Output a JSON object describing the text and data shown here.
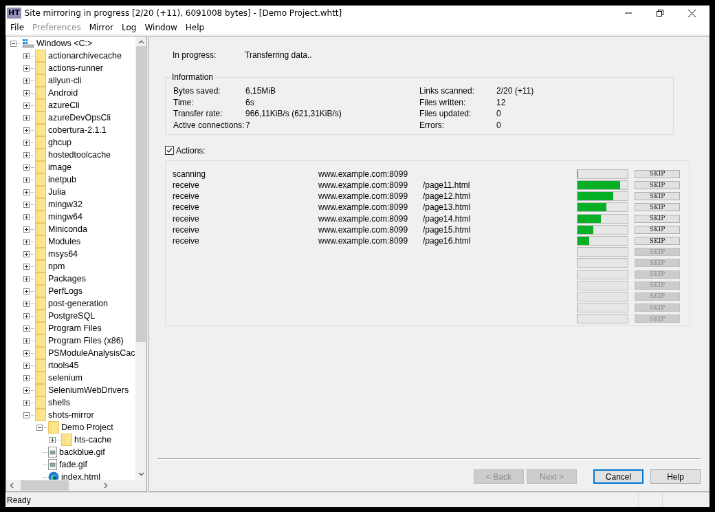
{
  "window": {
    "app_icon": "HT",
    "title": "Site mirroring in progress [2/20 (+11), 6091008 bytes] - [Demo Project.whtt]"
  },
  "menu": [
    {
      "label": "File",
      "disabled": false
    },
    {
      "label": "Preferences",
      "disabled": true
    },
    {
      "label": "Mirror",
      "disabled": false
    },
    {
      "label": "Log",
      "disabled": false
    },
    {
      "label": "Window",
      "disabled": false
    },
    {
      "label": "Help",
      "disabled": false
    }
  ],
  "tree": [
    {
      "label": "Windows <C:>",
      "kind": "drive",
      "expanded": true,
      "children": [
        {
          "label": "actionarchivecache",
          "kind": "folder",
          "expanded": false
        },
        {
          "label": "actions-runner",
          "kind": "folder",
          "expanded": false
        },
        {
          "label": "aliyun-cli",
          "kind": "folder",
          "expanded": false
        },
        {
          "label": "Android",
          "kind": "folder",
          "expanded": false
        },
        {
          "label": "azureCli",
          "kind": "folder",
          "expanded": false
        },
        {
          "label": "azureDevOpsCli",
          "kind": "folder",
          "expanded": false
        },
        {
          "label": "cobertura-2.1.1",
          "kind": "folder",
          "expanded": false
        },
        {
          "label": "ghcup",
          "kind": "folder",
          "expanded": false
        },
        {
          "label": "hostedtoolcache",
          "kind": "folder",
          "expanded": false
        },
        {
          "label": "image",
          "kind": "folder",
          "expanded": false
        },
        {
          "label": "inetpub",
          "kind": "folder",
          "expanded": false
        },
        {
          "label": "Julia",
          "kind": "folder",
          "expanded": false
        },
        {
          "label": "mingw32",
          "kind": "folder",
          "expanded": false
        },
        {
          "label": "mingw64",
          "kind": "folder",
          "expanded": false
        },
        {
          "label": "Miniconda",
          "kind": "folder",
          "expanded": false
        },
        {
          "label": "Modules",
          "kind": "folder",
          "expanded": false
        },
        {
          "label": "msys64",
          "kind": "folder",
          "expanded": false
        },
        {
          "label": "npm",
          "kind": "folder",
          "expanded": false
        },
        {
          "label": "Packages",
          "kind": "folder",
          "expanded": false
        },
        {
          "label": "PerfLogs",
          "kind": "folder",
          "expanded": false
        },
        {
          "label": "post-generation",
          "kind": "folder",
          "expanded": false
        },
        {
          "label": "PostgreSQL",
          "kind": "folder",
          "expanded": false
        },
        {
          "label": "Program Files",
          "kind": "folder",
          "expanded": false
        },
        {
          "label": "Program Files (x86)",
          "kind": "folder",
          "expanded": false
        },
        {
          "label": "PSModuleAnalysisCac",
          "kind": "folder",
          "expanded": false
        },
        {
          "label": "rtools45",
          "kind": "folder",
          "expanded": false
        },
        {
          "label": "selenium",
          "kind": "folder",
          "expanded": false
        },
        {
          "label": "SeleniumWebDrivers",
          "kind": "folder",
          "expanded": false
        },
        {
          "label": "shells",
          "kind": "folder",
          "expanded": false
        },
        {
          "label": "shots-mirror",
          "kind": "folder",
          "expanded": true,
          "children": [
            {
              "label": "Demo Project",
              "kind": "folder",
              "expanded": true,
              "children": [
                {
                  "label": "hts-cache",
                  "kind": "folder",
                  "expanded": false
                }
              ]
            },
            {
              "label": "backblue.gif",
              "kind": "image-file"
            },
            {
              "label": "fade.gif",
              "kind": "image-file"
            },
            {
              "label": "index.html",
              "kind": "web-file"
            }
          ]
        }
      ]
    }
  ],
  "progress": {
    "label": "In progress:",
    "value": "Transferring data.."
  },
  "information": {
    "title": "Information",
    "left": [
      {
        "label": "Bytes saved:",
        "value": "6,15MiB"
      },
      {
        "label": "Time:",
        "value": "6s"
      },
      {
        "label": "Transfer rate:",
        "value": "966,11KiB/s (621,31KiB/s)"
      },
      {
        "label": "Active connections:",
        "value": "7"
      }
    ],
    "right": [
      {
        "label": "Links scanned:",
        "value": "2/20 (+11)"
      },
      {
        "label": "Files written:",
        "value": "12"
      },
      {
        "label": "Files updated:",
        "value": "0"
      },
      {
        "label": "Errors:",
        "value": "0"
      }
    ]
  },
  "actions": {
    "label": "Actions:",
    "checked": true,
    "rows": [
      {
        "action": "scanning",
        "host": "www.example.com:8099",
        "level": 0.02,
        "skip": "SKIP",
        "disabled": false
      },
      {
        "action": "receive",
        "host": "www.example.com:8099",
        "path": "/page11.html",
        "level": 0.85,
        "skip": "SKIP",
        "disabled": false
      },
      {
        "action": "receive",
        "host": "www.example.com:8099",
        "path": "/page12.html",
        "level": 0.71,
        "skip": "SKIP",
        "disabled": false
      },
      {
        "action": "receive",
        "host": "www.example.com:8099",
        "path": "/page13.html",
        "level": 0.57,
        "skip": "SKIP",
        "disabled": false
      },
      {
        "action": "receive",
        "host": "www.example.com:8099",
        "path": "/page14.html",
        "level": 0.46,
        "skip": "SKIP",
        "disabled": false
      },
      {
        "action": "receive",
        "host": "www.example.com:8099",
        "path": "/page15.html",
        "level": 0.32,
        "skip": "SKIP",
        "disabled": false
      },
      {
        "action": "receive",
        "host": "www.example.com:8099",
        "path": "/page16.html",
        "level": 0.23,
        "skip": "SKIP",
        "disabled": false
      },
      {
        "level": 0,
        "skip": "SKIP",
        "disabled": true
      },
      {
        "level": 0,
        "skip": "SKIP",
        "disabled": true
      },
      {
        "level": 0,
        "skip": "SKIP",
        "disabled": true
      },
      {
        "level": 0,
        "skip": "SKIP",
        "disabled": true
      },
      {
        "level": 0,
        "skip": "SKIP",
        "disabled": true
      },
      {
        "level": 0,
        "skip": "SKIP",
        "disabled": true
      },
      {
        "level": 0,
        "skip": "SKIP",
        "disabled": true
      }
    ]
  },
  "buttons": [
    {
      "label": "< Back",
      "disabled": true,
      "focused": false
    },
    {
      "label": "Next >",
      "disabled": true,
      "focused": false
    },
    {
      "label": "Cancel",
      "disabled": false,
      "focused": true
    },
    {
      "label": "Help",
      "disabled": false,
      "focused": false
    }
  ],
  "status_bar": {
    "text": "Ready"
  }
}
